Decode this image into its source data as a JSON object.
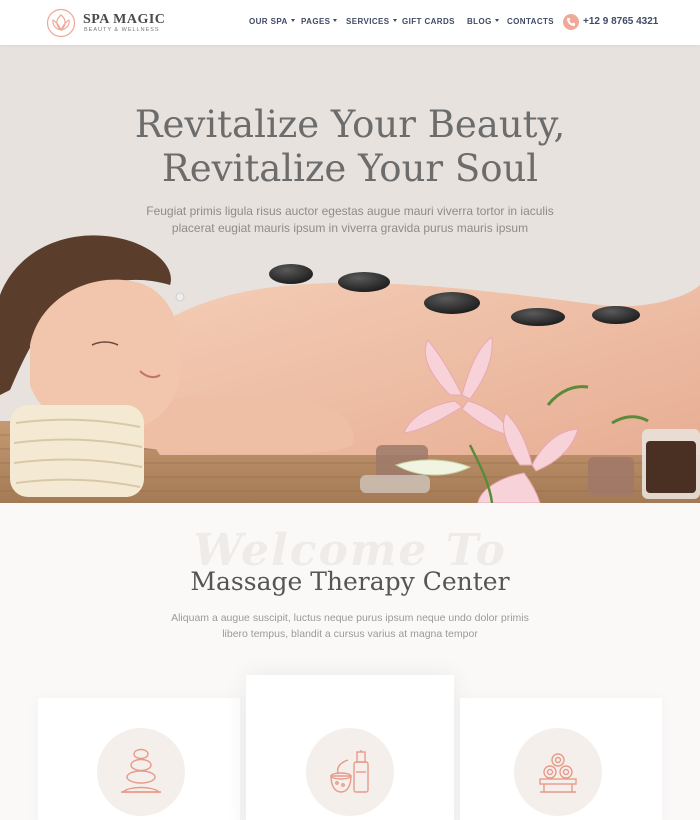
{
  "brand": {
    "name": "SPA MAGIC",
    "tagline": "BEAUTY & WELLNESS"
  },
  "nav": [
    {
      "label": "OUR SPA",
      "dropdown": true
    },
    {
      "label": "PAGES",
      "dropdown": true
    },
    {
      "label": "SERVICES",
      "dropdown": true
    },
    {
      "label": "GIFT CARDS",
      "dropdown": false
    },
    {
      "label": "BLOG",
      "dropdown": true
    },
    {
      "label": "CONTACTS",
      "dropdown": false
    }
  ],
  "phone": {
    "icon": "phone-icon",
    "number": "+12 9 8765 4321"
  },
  "hero": {
    "title_line1": "Revitalize Your Beauty,",
    "title_line2": "Revitalize Your Soul",
    "subtitle_line1": "Feugiat primis ligula risus auctor egestas augue mauri viverra tortor in iaculis",
    "subtitle_line2": "placerat eugiat mauris ipsum in viverra gravida purus mauris ipsum"
  },
  "welcome": {
    "script_text": "Welcome To",
    "title": "Massage Therapy Center",
    "text_line1": "Aliquam a augue suscipit, luctus neque purus ipsum neque undo dolor primis",
    "text_line2": "libero tempus, blandit a cursus varius at magna tempor"
  },
  "services": [
    {
      "icon": "stacked-stones-icon"
    },
    {
      "icon": "spa-products-icon"
    },
    {
      "icon": "rolled-towels-icon"
    }
  ],
  "colors": {
    "accent": "#f0a898",
    "nav": "#3f4a66",
    "hero_bg": "#e8e2de",
    "icon_line": "#e89a88"
  }
}
